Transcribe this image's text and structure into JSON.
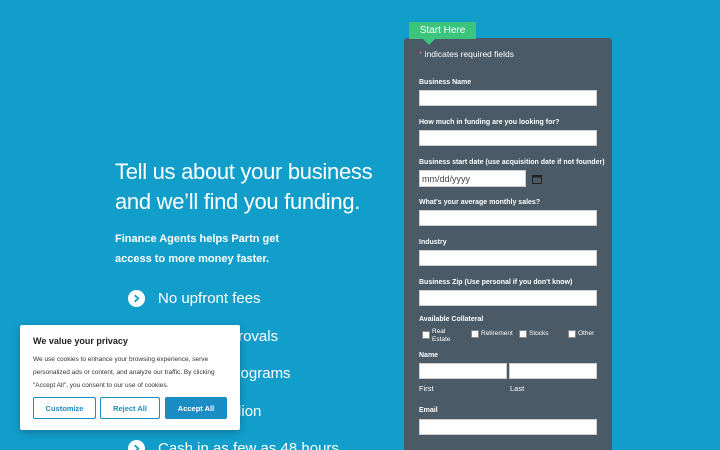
{
  "hero": {
    "title": "Tell us about your business and we’ll find you funding.",
    "subtitle": "Finance Agents helps Partn get access to more money faster.",
    "benefits": [
      "No upfront fees",
      "24 hour approvals",
      "Financing programs",
      "Up to $5 Million",
      "Cash in as few as 48 hours"
    ]
  },
  "form": {
    "tab_label": "Start Here",
    "required_star": "*",
    "required_note": " indicates required fields",
    "fields": {
      "business_name": "Business Name",
      "funding_amount": "How much in funding are you looking for?",
      "start_date": "Business start date (use acquisition date if not founder)",
      "start_date_placeholder": "mm/dd/yyyy",
      "monthly_sales": "What's your average monthly sales?",
      "industry": "Industry",
      "zip": "Business Zip (Use personal if you don't know)",
      "collateral": "Available Collateral",
      "collateral_options": [
        "Real Estate",
        "Retirement",
        "Stocks",
        "Other"
      ],
      "name": "Name",
      "first": "First",
      "last": "Last",
      "email": "Email"
    }
  },
  "cookie": {
    "title": "We value your privacy",
    "text": "We use cookies to enhance your browsing experience, serve personalized ads or content, and analyze our traffic. By clicking \"Accept All\", you consent to our use of cookies.",
    "customize": "Customize",
    "reject": "Reject All",
    "accept": "Accept All"
  },
  "colors": {
    "background": "#129ecb",
    "form": "#4a5a66",
    "tab": "#3cc47c",
    "button": "#1a8ec4"
  }
}
